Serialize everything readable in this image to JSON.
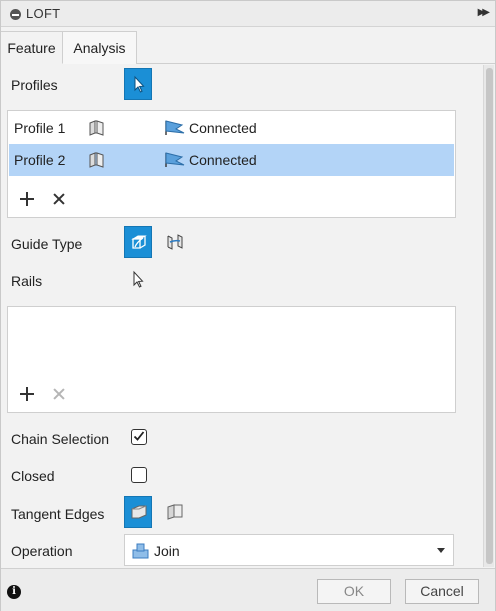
{
  "window": {
    "title": "LOFT",
    "title_icon": "minus-circle-icon",
    "collapse_icon": "double-chevron-right-icon"
  },
  "tabs": [
    {
      "label": "Feature",
      "active": true
    },
    {
      "label": "Analysis",
      "active": false
    }
  ],
  "profiles": {
    "label": "Profiles",
    "select_icon": "cursor-arrow-icon",
    "items": [
      {
        "name": "Profile 1",
        "icon": "profile-shape-icon",
        "status_icon": "flag-icon",
        "status": "Connected",
        "selected": false
      },
      {
        "name": "Profile 2",
        "icon": "profile-shape-icon",
        "status_icon": "flag-icon",
        "status": "Connected",
        "selected": true
      }
    ],
    "add_icon": "plus-icon",
    "remove_icon": "x-icon"
  },
  "guide_type": {
    "label": "Guide Type",
    "options": [
      "rails-guide-icon",
      "centerline-guide-icon"
    ],
    "selected": "rails-guide-icon"
  },
  "rails": {
    "label": "Rails",
    "select_icon": "cursor-arrow-icon",
    "items": [],
    "add_icon": "plus-icon",
    "remove_icon": "x-icon"
  },
  "chain_selection": {
    "label": "Chain Selection",
    "checked": true
  },
  "closed": {
    "label": "Closed",
    "checked": false
  },
  "tangent_edges": {
    "label": "Tangent Edges",
    "options": [
      "tangent-merge-icon",
      "tangent-separate-icon"
    ],
    "selected": "tangent-merge-icon"
  },
  "operation": {
    "label": "Operation",
    "value": "Join",
    "icon": "join-icon"
  },
  "footer": {
    "info_icon": "info-icon",
    "ok_label": "OK",
    "cancel_label": "Cancel"
  },
  "colors": {
    "accent": "#1b8fd6",
    "selection": "#b3d4f7",
    "panel_bg": "#f2f2f2"
  }
}
